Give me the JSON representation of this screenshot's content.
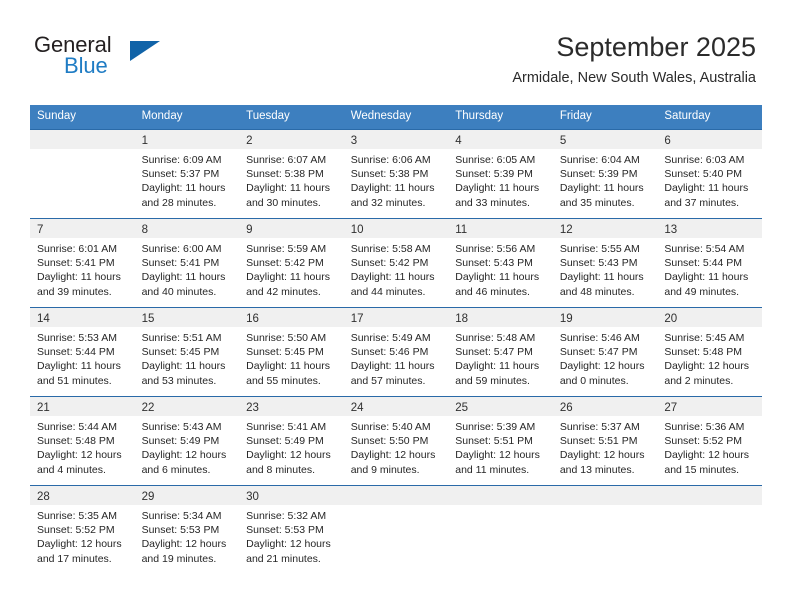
{
  "brand": {
    "name_part1": "General",
    "name_part2": "Blue",
    "triangle_color": "#1063a8",
    "blue_color": "#1f7cc4"
  },
  "header": {
    "title": "September 2025",
    "location": "Armidale, New South Wales, Australia"
  },
  "theme": {
    "header_bg": "#3d7fbf",
    "row_divider": "#2a6aa8",
    "day_band_bg": "#f0f0f0"
  },
  "weekdays": [
    "Sunday",
    "Monday",
    "Tuesday",
    "Wednesday",
    "Thursday",
    "Friday",
    "Saturday"
  ],
  "weeks": [
    [
      {
        "day": "",
        "sunrise": "",
        "sunset": "",
        "daylight_line1": "",
        "daylight_line2": ""
      },
      {
        "day": "1",
        "sunrise": "Sunrise: 6:09 AM",
        "sunset": "Sunset: 5:37 PM",
        "daylight_line1": "Daylight: 11 hours",
        "daylight_line2": "and 28 minutes."
      },
      {
        "day": "2",
        "sunrise": "Sunrise: 6:07 AM",
        "sunset": "Sunset: 5:38 PM",
        "daylight_line1": "Daylight: 11 hours",
        "daylight_line2": "and 30 minutes."
      },
      {
        "day": "3",
        "sunrise": "Sunrise: 6:06 AM",
        "sunset": "Sunset: 5:38 PM",
        "daylight_line1": "Daylight: 11 hours",
        "daylight_line2": "and 32 minutes."
      },
      {
        "day": "4",
        "sunrise": "Sunrise: 6:05 AM",
        "sunset": "Sunset: 5:39 PM",
        "daylight_line1": "Daylight: 11 hours",
        "daylight_line2": "and 33 minutes."
      },
      {
        "day": "5",
        "sunrise": "Sunrise: 6:04 AM",
        "sunset": "Sunset: 5:39 PM",
        "daylight_line1": "Daylight: 11 hours",
        "daylight_line2": "and 35 minutes."
      },
      {
        "day": "6",
        "sunrise": "Sunrise: 6:03 AM",
        "sunset": "Sunset: 5:40 PM",
        "daylight_line1": "Daylight: 11 hours",
        "daylight_line2": "and 37 minutes."
      }
    ],
    [
      {
        "day": "7",
        "sunrise": "Sunrise: 6:01 AM",
        "sunset": "Sunset: 5:41 PM",
        "daylight_line1": "Daylight: 11 hours",
        "daylight_line2": "and 39 minutes."
      },
      {
        "day": "8",
        "sunrise": "Sunrise: 6:00 AM",
        "sunset": "Sunset: 5:41 PM",
        "daylight_line1": "Daylight: 11 hours",
        "daylight_line2": "and 40 minutes."
      },
      {
        "day": "9",
        "sunrise": "Sunrise: 5:59 AM",
        "sunset": "Sunset: 5:42 PM",
        "daylight_line1": "Daylight: 11 hours",
        "daylight_line2": "and 42 minutes."
      },
      {
        "day": "10",
        "sunrise": "Sunrise: 5:58 AM",
        "sunset": "Sunset: 5:42 PM",
        "daylight_line1": "Daylight: 11 hours",
        "daylight_line2": "and 44 minutes."
      },
      {
        "day": "11",
        "sunrise": "Sunrise: 5:56 AM",
        "sunset": "Sunset: 5:43 PM",
        "daylight_line1": "Daylight: 11 hours",
        "daylight_line2": "and 46 minutes."
      },
      {
        "day": "12",
        "sunrise": "Sunrise: 5:55 AM",
        "sunset": "Sunset: 5:43 PM",
        "daylight_line1": "Daylight: 11 hours",
        "daylight_line2": "and 48 minutes."
      },
      {
        "day": "13",
        "sunrise": "Sunrise: 5:54 AM",
        "sunset": "Sunset: 5:44 PM",
        "daylight_line1": "Daylight: 11 hours",
        "daylight_line2": "and 49 minutes."
      }
    ],
    [
      {
        "day": "14",
        "sunrise": "Sunrise: 5:53 AM",
        "sunset": "Sunset: 5:44 PM",
        "daylight_line1": "Daylight: 11 hours",
        "daylight_line2": "and 51 minutes."
      },
      {
        "day": "15",
        "sunrise": "Sunrise: 5:51 AM",
        "sunset": "Sunset: 5:45 PM",
        "daylight_line1": "Daylight: 11 hours",
        "daylight_line2": "and 53 minutes."
      },
      {
        "day": "16",
        "sunrise": "Sunrise: 5:50 AM",
        "sunset": "Sunset: 5:45 PM",
        "daylight_line1": "Daylight: 11 hours",
        "daylight_line2": "and 55 minutes."
      },
      {
        "day": "17",
        "sunrise": "Sunrise: 5:49 AM",
        "sunset": "Sunset: 5:46 PM",
        "daylight_line1": "Daylight: 11 hours",
        "daylight_line2": "and 57 minutes."
      },
      {
        "day": "18",
        "sunrise": "Sunrise: 5:48 AM",
        "sunset": "Sunset: 5:47 PM",
        "daylight_line1": "Daylight: 11 hours",
        "daylight_line2": "and 59 minutes."
      },
      {
        "day": "19",
        "sunrise": "Sunrise: 5:46 AM",
        "sunset": "Sunset: 5:47 PM",
        "daylight_line1": "Daylight: 12 hours",
        "daylight_line2": "and 0 minutes."
      },
      {
        "day": "20",
        "sunrise": "Sunrise: 5:45 AM",
        "sunset": "Sunset: 5:48 PM",
        "daylight_line1": "Daylight: 12 hours",
        "daylight_line2": "and 2 minutes."
      }
    ],
    [
      {
        "day": "21",
        "sunrise": "Sunrise: 5:44 AM",
        "sunset": "Sunset: 5:48 PM",
        "daylight_line1": "Daylight: 12 hours",
        "daylight_line2": "and 4 minutes."
      },
      {
        "day": "22",
        "sunrise": "Sunrise: 5:43 AM",
        "sunset": "Sunset: 5:49 PM",
        "daylight_line1": "Daylight: 12 hours",
        "daylight_line2": "and 6 minutes."
      },
      {
        "day": "23",
        "sunrise": "Sunrise: 5:41 AM",
        "sunset": "Sunset: 5:49 PM",
        "daylight_line1": "Daylight: 12 hours",
        "daylight_line2": "and 8 minutes."
      },
      {
        "day": "24",
        "sunrise": "Sunrise: 5:40 AM",
        "sunset": "Sunset: 5:50 PM",
        "daylight_line1": "Daylight: 12 hours",
        "daylight_line2": "and 9 minutes."
      },
      {
        "day": "25",
        "sunrise": "Sunrise: 5:39 AM",
        "sunset": "Sunset: 5:51 PM",
        "daylight_line1": "Daylight: 12 hours",
        "daylight_line2": "and 11 minutes."
      },
      {
        "day": "26",
        "sunrise": "Sunrise: 5:37 AM",
        "sunset": "Sunset: 5:51 PM",
        "daylight_line1": "Daylight: 12 hours",
        "daylight_line2": "and 13 minutes."
      },
      {
        "day": "27",
        "sunrise": "Sunrise: 5:36 AM",
        "sunset": "Sunset: 5:52 PM",
        "daylight_line1": "Daylight: 12 hours",
        "daylight_line2": "and 15 minutes."
      }
    ],
    [
      {
        "day": "28",
        "sunrise": "Sunrise: 5:35 AM",
        "sunset": "Sunset: 5:52 PM",
        "daylight_line1": "Daylight: 12 hours",
        "daylight_line2": "and 17 minutes."
      },
      {
        "day": "29",
        "sunrise": "Sunrise: 5:34 AM",
        "sunset": "Sunset: 5:53 PM",
        "daylight_line1": "Daylight: 12 hours",
        "daylight_line2": "and 19 minutes."
      },
      {
        "day": "30",
        "sunrise": "Sunrise: 5:32 AM",
        "sunset": "Sunset: 5:53 PM",
        "daylight_line1": "Daylight: 12 hours",
        "daylight_line2": "and 21 minutes."
      },
      {
        "day": "",
        "sunrise": "",
        "sunset": "",
        "daylight_line1": "",
        "daylight_line2": ""
      },
      {
        "day": "",
        "sunrise": "",
        "sunset": "",
        "daylight_line1": "",
        "daylight_line2": ""
      },
      {
        "day": "",
        "sunrise": "",
        "sunset": "",
        "daylight_line1": "",
        "daylight_line2": ""
      },
      {
        "day": "",
        "sunrise": "",
        "sunset": "",
        "daylight_line1": "",
        "daylight_line2": ""
      }
    ]
  ]
}
